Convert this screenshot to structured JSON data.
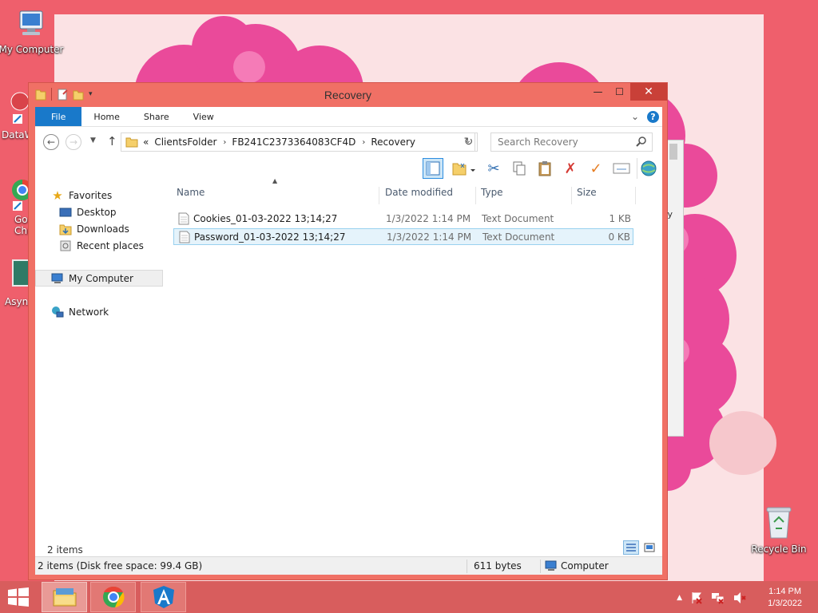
{
  "colors": {
    "desktop": "#ef5f6c",
    "window_frame": "#f07065",
    "accent": "#1979ca",
    "taskbar": "#d85d5d"
  },
  "desktop": {
    "icons": [
      {
        "label": "My Computer",
        "icon": "my-computer-icon"
      },
      {
        "label": "Recycle Bin",
        "icon": "recycle-bin-icon"
      }
    ],
    "partial_labels": [
      "DataW",
      "Goo",
      "Chr",
      "Async"
    ],
    "background_window_text": "ry"
  },
  "window": {
    "title": "Recovery",
    "controls": {
      "minimize": "—",
      "maximize": "☐",
      "close": "✕"
    },
    "ribbon": {
      "tabs": [
        "File",
        "Home",
        "Share",
        "View"
      ],
      "expand_glyph": "⌄",
      "help": "?"
    },
    "address": {
      "overflow": "«",
      "breadcrumbs": [
        "ClientsFolder",
        "FB241C2373364083CF4D",
        "Recovery"
      ],
      "search_placeholder": "Search Recovery"
    },
    "nav": {
      "favorites_label": "Favorites",
      "favorites": [
        "Desktop",
        "Downloads",
        "Recent places"
      ],
      "computer": "My Computer",
      "network": "Network"
    },
    "columns": {
      "name": "Name",
      "date": "Date modified",
      "type": "Type",
      "size": "Size"
    },
    "files": [
      {
        "name": "Cookies_01-03-2022 13;14;27",
        "date": "1/3/2022 1:14 PM",
        "type": "Text Document",
        "size": "1 KB",
        "selected": false
      },
      {
        "name": "Password_01-03-2022 13;14;27",
        "date": "1/3/2022 1:14 PM",
        "type": "Text Document",
        "size": "0 KB",
        "selected": true
      }
    ],
    "item_count": "2 items",
    "status": {
      "summary": "2 items (Disk free space: 99.4 GB)",
      "size": "611 bytes",
      "location": "Computer"
    }
  },
  "taskbar": {
    "apps": [
      "file-explorer-icon",
      "chrome-icon",
      "angular-icon"
    ],
    "time": "1:14 PM",
    "date": "1/3/2022"
  }
}
